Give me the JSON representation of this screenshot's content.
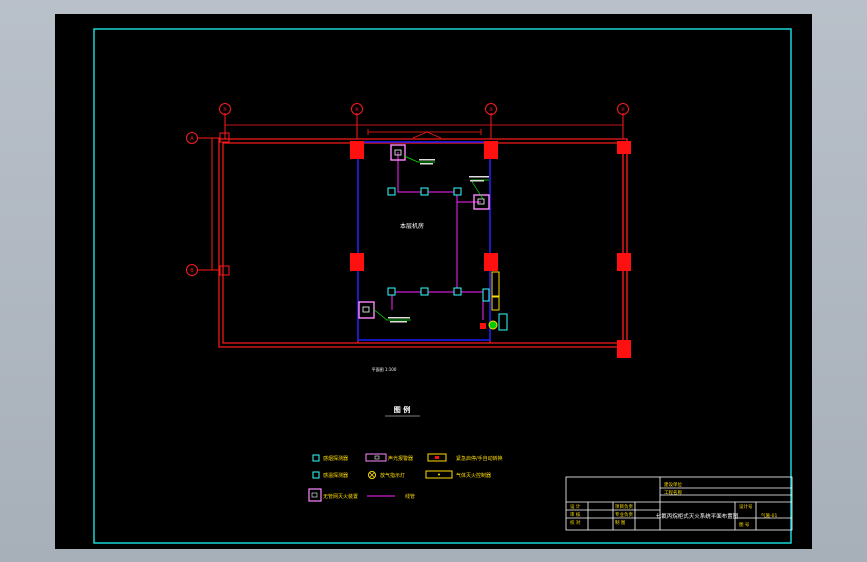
{
  "drawing": {
    "axis_labels": {
      "top": [
        "⑤",
        "④",
        "③",
        "②"
      ],
      "left": [
        "A",
        "B"
      ]
    },
    "room_label": "本层机房",
    "dim_note": "平面图 1:100",
    "legend_title": "图  例",
    "legend_items": [
      {
        "icon": "smoke-detector-icon",
        "label": "感烟探测器"
      },
      {
        "icon": "alarm-bell-icon",
        "label": "声光报警器"
      },
      {
        "icon": "emergency-stop-icon",
        "label": "紧急启停/手自动转换"
      },
      {
        "icon": "heat-detector-icon",
        "label": "感温探测器"
      },
      {
        "icon": "release-light-icon",
        "label": "放气指示灯"
      },
      {
        "icon": "gas-cabinet-icon",
        "label": "气体灭火控制器"
      },
      {
        "icon": "extinguisher-unit-icon",
        "label": "无管网灭火装置"
      },
      {
        "icon": "wire-icon",
        "label": "线管"
      }
    ],
    "title_block": {
      "rows_left": [
        "设 计",
        "审 核",
        "校 对"
      ],
      "rows_mid": [
        "项目负责",
        "专业负责",
        "制 图"
      ],
      "top_cells": [
        "建设单位",
        "工程名称"
      ],
      "main_title": "七氟丙烷柜式灭火系统平面布置图",
      "right_labels": [
        "设计号",
        "图 号"
      ],
      "sheet_no": "气施-01"
    },
    "colors": {
      "frame": "#18d6d6",
      "wall": "#ff1a1a",
      "room": "#1d1dff",
      "wire": "#ff22ff",
      "device": "#33ffff",
      "callout": "#00ee00"
    }
  }
}
